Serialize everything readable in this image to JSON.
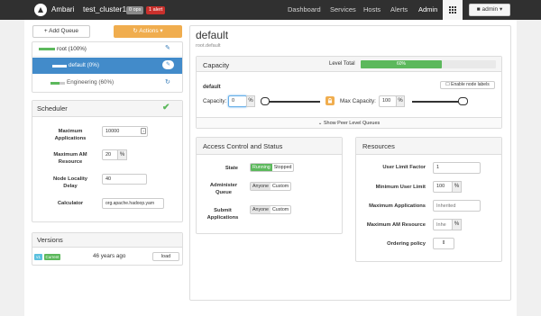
{
  "nav": {
    "brand": "Ambari",
    "cluster": "test_cluster1",
    "ops_badge": "0 ops",
    "alert_badge": "1 alert",
    "links": [
      "Dashboard",
      "Services",
      "Hosts",
      "Alerts",
      "Admin"
    ],
    "user_button": "admin"
  },
  "sidebar": {
    "add_queue": "+ Add Queue",
    "actions": "Actions",
    "queues": [
      {
        "label": "root (100%)",
        "capacity": 1.0
      },
      {
        "label": "default (0%)",
        "capacity": 0.0
      },
      {
        "label": "Engineering (60%)",
        "capacity": 0.6
      }
    ],
    "scheduler": {
      "title": "Scheduler",
      "max_apps_label": "Maximum Applications",
      "max_apps_value": "10000",
      "max_am_label": "Maximum AM Resource",
      "max_am_value": "20",
      "max_am_unit": "%",
      "locality_label": "Node Locality Delay",
      "locality_value": "40",
      "calculator_label": "Calculator",
      "calculator_value": "org.apache.hadoop.yarn"
    },
    "versions": {
      "title": "Versions",
      "version_tag": "v1",
      "current_tag": "Current",
      "age": "46 years ago",
      "load_button": "load"
    }
  },
  "queue": {
    "title": "default",
    "path": "root.default",
    "capacity": {
      "title": "Capacity",
      "level_total_label": "Level Total",
      "level_total_value": "60%",
      "level_total_fraction": 0.6,
      "queue_name": "default",
      "enable_labels": "Enable node labels",
      "capacity_label": "Capacity:",
      "capacity_value": "0",
      "capacity_unit": "%",
      "max_capacity_label": "Max Capacity:",
      "max_capacity_value": "100",
      "max_capacity_unit": "%",
      "peer_link": "Show Peer Level Queues"
    },
    "access": {
      "title": "Access Control and Status",
      "state_label": "State",
      "state_options": [
        "Running",
        "Stopped"
      ],
      "administer_label": "Administer Queue",
      "administer_options": [
        "Anyone",
        "Custom"
      ],
      "submit_label": "Submit Applications",
      "submit_options": [
        "Anyone",
        "Custom"
      ]
    },
    "resources": {
      "title": "Resources",
      "user_limit_factor_label": "User Limit Factor",
      "user_limit_factor_value": "1",
      "min_user_limit_label": "Minimum User Limit",
      "min_user_limit_value": "100",
      "min_user_limit_unit": "%",
      "max_apps_label": "Maximum Applications",
      "max_apps_placeholder": "Inherited",
      "max_am_label": "Maximum AM Resource",
      "max_am_placeholder": "Inhe",
      "max_am_unit": "%",
      "ordering_label": "Ordering policy"
    }
  }
}
